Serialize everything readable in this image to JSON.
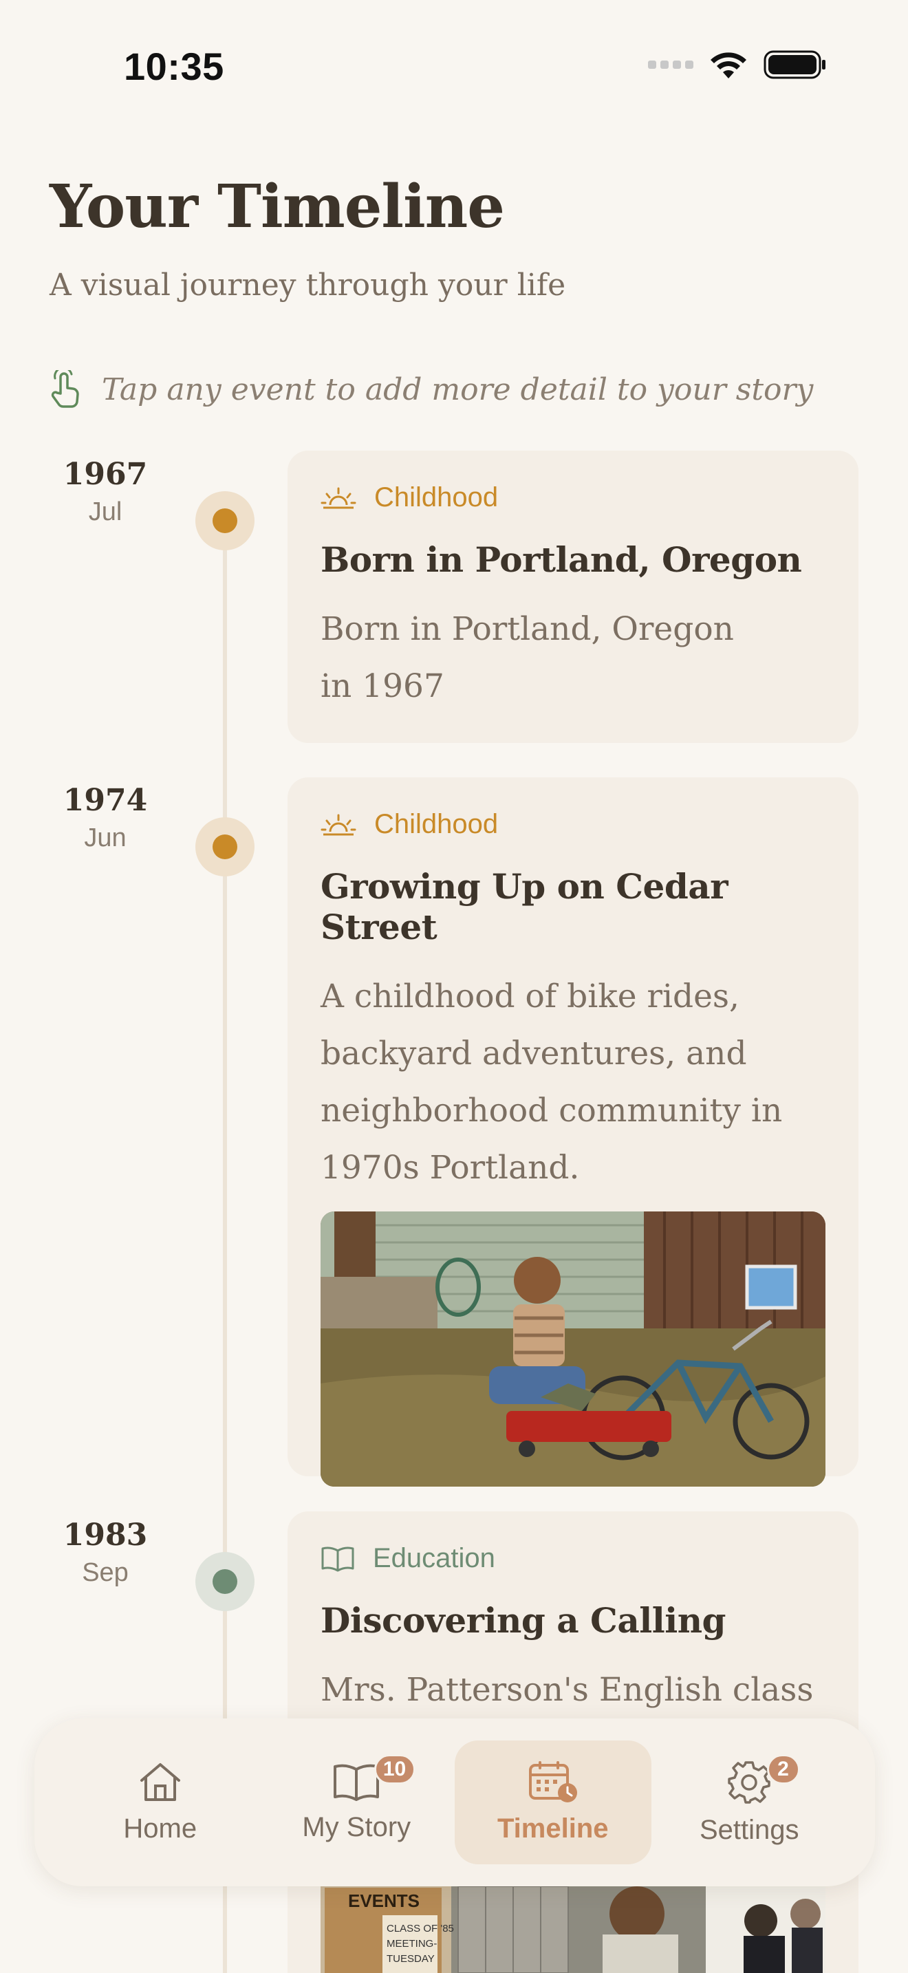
{
  "status_bar": {
    "time": "10:35"
  },
  "header": {
    "title": "Your Timeline",
    "subtitle": "A visual journey through your life"
  },
  "hint": {
    "text": "Tap any event to add more detail to your story",
    "icon": "tap-hand-icon"
  },
  "colors": {
    "childhood": "#c98a28",
    "education": "#6e8c74",
    "accent": "#c7895e",
    "background": "#f9f6f1",
    "card": "#f4eee6"
  },
  "entries": [
    {
      "year": "1967",
      "month": "Jul",
      "category": "Childhood",
      "category_icon": "sunrise-icon",
      "title": "Born in Portland, Oregon",
      "body_lines": [
        "Born in Portland, Oregon",
        "in 1967"
      ]
    },
    {
      "year": "1974",
      "month": "Jun",
      "category": "Childhood",
      "category_icon": "sunrise-icon",
      "title": "Growing Up on Cedar Street",
      "body_lines": [
        "A childhood of bike rides,",
        "backyard adventures, and",
        "neighborhood community in",
        "1970s Portland."
      ]
    },
    {
      "year": "1983",
      "month": "Sep",
      "category": "Education",
      "category_icon": "open-book-icon",
      "title": "Discovering a Calling",
      "body_lines": [
        "Mrs. Patterson's English class"
      ]
    }
  ],
  "bulletin": {
    "line1": "EVENTS",
    "line2": "CLASS OF '85",
    "line3": "MEETING-",
    "line4": "TUESDAY"
  },
  "nav": {
    "items": [
      {
        "label": "Home",
        "icon": "house-icon",
        "badge": ""
      },
      {
        "label": "My Story",
        "icon": "book-icon",
        "badge": "10"
      },
      {
        "label": "Timeline",
        "icon": "calendar-clock-icon",
        "badge": "",
        "active": true
      },
      {
        "label": "Settings",
        "icon": "gear-icon",
        "badge": "2"
      }
    ]
  }
}
